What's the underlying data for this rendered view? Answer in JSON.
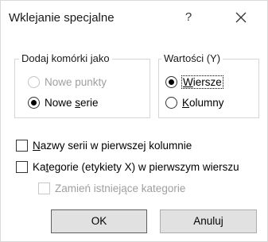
{
  "dialog": {
    "title": "Wklejanie specjalne",
    "help_label": "?"
  },
  "add_cells": {
    "label": "Dodaj komórki jako",
    "option_new_points": "Nowe punkty",
    "option_new_series_pre": "Nowe ",
    "option_new_series_accel": "s",
    "option_new_series_post": "erie"
  },
  "values": {
    "label": "Wartości (Y)",
    "option_rows_accel": "W",
    "option_rows_rest": "iersze",
    "option_columns_accel": "K",
    "option_columns_rest": "olumny"
  },
  "checks": {
    "series_names_accel": "N",
    "series_names_rest": "azwy serii w pierwszej kolumnie",
    "categories_pre": "Ka",
    "categories_accel": "t",
    "categories_post": "egorie (etykiety X) w pierwszym wierszu",
    "replace_categories": "Zamień istniejące kategorie"
  },
  "buttons": {
    "ok": "OK",
    "cancel": "Anuluj"
  }
}
